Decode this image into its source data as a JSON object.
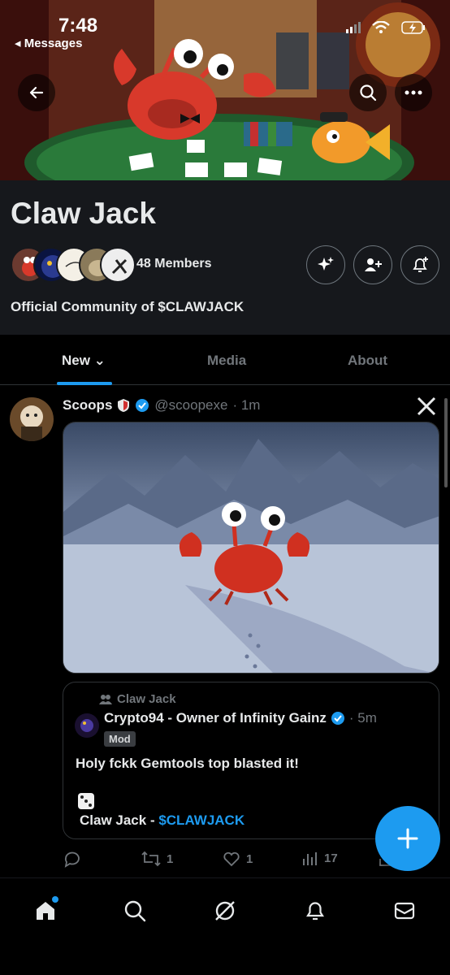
{
  "status_bar": {
    "time": "7:48",
    "back_app": "◂ Messages"
  },
  "community": {
    "name": "Claw Jack",
    "members_label": "48 Members",
    "description": "Official Community of $CLAWJACK"
  },
  "tabs": [
    {
      "label": "New ⌄",
      "active": true
    },
    {
      "label": "Media",
      "active": false
    },
    {
      "label": "About",
      "active": false
    }
  ],
  "post": {
    "author_name": "Scoops",
    "author_handle": "@scoopexe",
    "time": "· 1m",
    "quote": {
      "community_label": "Claw Jack",
      "author_name": "Crypto94 - Owner of Infinity Gainz",
      "time": "· 5m",
      "badge": "Mod",
      "text": "Holy fckk Gemtools top blasted it!",
      "footer_prefix": "Claw Jack - ",
      "footer_tag": "$CLAWJACK"
    },
    "actions": {
      "replies": "",
      "reposts": "1",
      "likes": "1",
      "views": "17"
    }
  },
  "colors": {
    "accent": "#1d9bf0",
    "background": "#000000",
    "header_bg": "#16181c",
    "muted": "#71767b"
  },
  "icons": [
    "back-arrow-icon",
    "search-icon",
    "more-icon",
    "sparkle-icon",
    "add-member-icon",
    "bell-plus-icon",
    "verified-icon",
    "x-logo-icon",
    "reply-icon",
    "repost-icon",
    "like-icon",
    "views-icon",
    "share-icon",
    "plus-icon",
    "home-icon",
    "explore-icon",
    "grok-icon",
    "notifications-icon",
    "messages-icon"
  ]
}
